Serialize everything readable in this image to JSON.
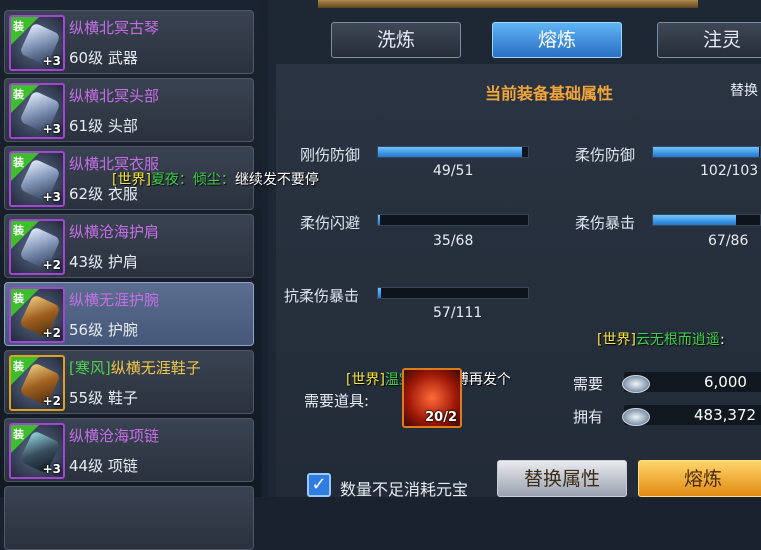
{
  "equipment_list": [
    {
      "badge": "装",
      "name": "纵横北冥古琴",
      "level": "60级 武器",
      "plus": "+3"
    },
    {
      "badge": "装",
      "name": "纵横北冥头部",
      "level": "61级 头部",
      "plus": "+3"
    },
    {
      "badge": "装",
      "name": "纵横北冥衣服",
      "level": "62级 衣服",
      "plus": "+3"
    },
    {
      "badge": "装",
      "name": "纵横沧海护肩",
      "level": "43级 护肩",
      "plus": "+2"
    },
    {
      "badge": "装",
      "name": "纵横无涯护腕",
      "level": "56级 护腕",
      "plus": "+2"
    },
    {
      "badge": "装",
      "prefix": "[寒风]",
      "name": "纵横无涯鞋子",
      "level": "55级 鞋子",
      "plus": "+2"
    },
    {
      "badge": "装",
      "name": "纵横沧海项链",
      "level": "44级 项链",
      "plus": "+3"
    }
  ],
  "tabs": {
    "wash": "洗炼",
    "smelt": "熔炼",
    "inject": "注灵"
  },
  "section": {
    "title": "当前装备基础属性",
    "replace": "替换"
  },
  "stats": [
    {
      "label": "刚伤防御",
      "value": "49/51",
      "ratio": 0.96
    },
    {
      "label": "柔伤防御",
      "value": "102/103",
      "ratio": 0.99
    },
    {
      "label": "柔伤闪避",
      "value": "35/68",
      "ratio": 0.01
    },
    {
      "label": "柔伤暴击",
      "value": "67/86",
      "ratio": 0.78
    },
    {
      "label": "抗柔伤暴击",
      "value": "57/111",
      "ratio": 0.02
    }
  ],
  "chat": [
    {
      "channel": "[世界]",
      "name": "夏夜：倾尘：",
      "message": "继续发不要停"
    },
    {
      "channel": "[世界]",
      "name": "云无根而逍遥",
      "message": ":"
    },
    {
      "channel": "[世界]",
      "name": "温宝",
      "message": "便宜师傅再发个"
    }
  ],
  "requirement": {
    "label": "需要道具:",
    "item_count": "20/2",
    "need_label": "需要",
    "need_value": "6,000",
    "have_label": "拥有",
    "have_value": "483,372"
  },
  "footer": {
    "checkbox_label": "数量不足消耗元宝",
    "replace_button": "替换属性",
    "smelt_button": "熔炼"
  },
  "colors": {
    "purple_name": "#c46fe6",
    "gold_name": "#f0c64a",
    "active_tab": "#2a6fc4",
    "bar": "#1f78d0",
    "accent_orange": "#f3a53a"
  }
}
